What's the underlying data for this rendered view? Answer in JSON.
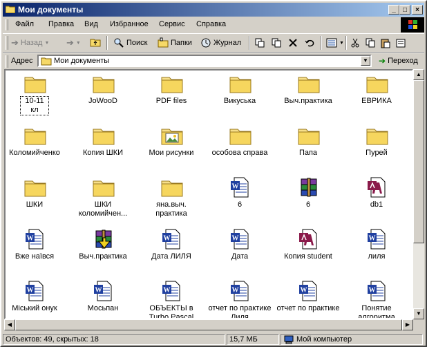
{
  "window": {
    "title": "Мои документы",
    "buttons": {
      "minimize": "_",
      "maximize": "□",
      "close": "×"
    }
  },
  "menu": [
    "Файл",
    "Правка",
    "Вид",
    "Избранное",
    "Сервис",
    "Справка"
  ],
  "toolbar": {
    "back": "Назад",
    "search": "Поиск",
    "folders": "Папки",
    "history": "Журнал"
  },
  "address": {
    "label": "Адрес",
    "value": "Мои документы",
    "go": "Переход"
  },
  "items": [
    {
      "label": "10-11 кл",
      "icon": "folder-icon"
    },
    {
      "label": "JoWooD",
      "icon": "folder-icon"
    },
    {
      "label": "PDF files",
      "icon": "folder-icon"
    },
    {
      "label": "Викуська",
      "icon": "folder-icon"
    },
    {
      "label": "Выч.практика",
      "icon": "folder-icon"
    },
    {
      "label": "ЕВРИКА",
      "icon": "folder-icon"
    },
    {
      "label": "Коломийченко",
      "icon": "folder-icon"
    },
    {
      "label": "Копия ШКИ",
      "icon": "folder-icon"
    },
    {
      "label": "Мои рисунки",
      "icon": "pictures-folder-icon"
    },
    {
      "label": "особова справа",
      "icon": "folder-icon"
    },
    {
      "label": "Папа",
      "icon": "folder-icon"
    },
    {
      "label": "Пурей",
      "icon": "folder-icon"
    },
    {
      "label": "ШКИ",
      "icon": "folder-icon"
    },
    {
      "label": "ШКИ коломийчен...",
      "icon": "folder-icon"
    },
    {
      "label": "яна.выч. практика",
      "icon": "folder-icon"
    },
    {
      "label": "6",
      "icon": "word-doc-icon"
    },
    {
      "label": "6",
      "icon": "winrar-archive-icon"
    },
    {
      "label": "db1",
      "icon": "access-db-icon"
    },
    {
      "label": "Вже наївся",
      "icon": "word-doc-icon"
    },
    {
      "label": "Выч.практика",
      "icon": "winzip-archive-icon"
    },
    {
      "label": "Дата ЛИЛЯ",
      "icon": "word-doc-icon"
    },
    {
      "label": "Дата",
      "icon": "word-doc-icon"
    },
    {
      "label": "Копия student",
      "icon": "access-db-icon"
    },
    {
      "label": "лиля",
      "icon": "word-doc-icon"
    },
    {
      "label": "Міський онук",
      "icon": "word-doc-icon"
    },
    {
      "label": "Мосьпан",
      "icon": "word-doc-icon"
    },
    {
      "label": "ОБЪЕКТЫ в Turbo Pascal",
      "icon": "word-doc-icon"
    },
    {
      "label": "отчет по практике Лиля",
      "icon": "word-doc-icon"
    },
    {
      "label": "отчет по практике",
      "icon": "word-doc-icon"
    },
    {
      "label": "Понятие алгоритма",
      "icon": "word-doc-icon"
    }
  ],
  "status": {
    "objects": "Объектов: 49, скрытых: 18",
    "size": "15,7 МБ",
    "location": "Мой компьютер"
  }
}
